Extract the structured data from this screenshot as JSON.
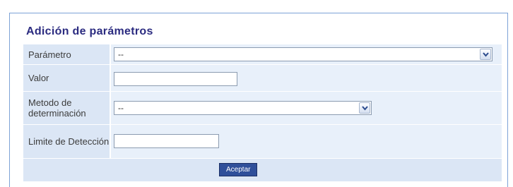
{
  "form": {
    "title": "Adición de parámetros",
    "parametro_label": "Parámetro",
    "parametro_value": "--",
    "valor_label": "Valor",
    "valor_value": "",
    "metodo_label": "Metodo de determinación",
    "metodo_value": "--",
    "limite_label": "Limite de Detección",
    "limite_value": "",
    "submit_label": "Aceptar"
  },
  "icons": {
    "dropdown_arrow": "chevron-down-icon"
  },
  "colors": {
    "title": "#2b2b80",
    "label_background": "#dbe6f5",
    "cell_background": "#e8f0fa",
    "button": "#2f4f9a",
    "frame_border": "#7da2d6"
  }
}
